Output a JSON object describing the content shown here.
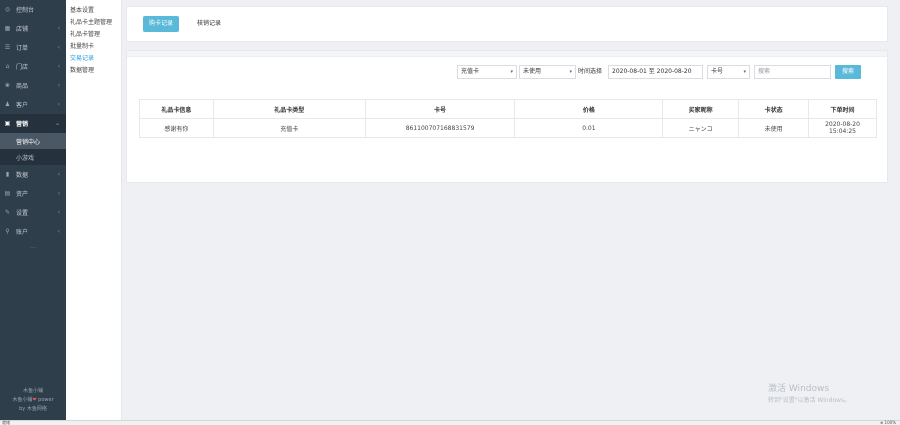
{
  "sidebar": {
    "items": [
      {
        "icon": "dashboard-icon",
        "glyph": "◎",
        "label": "控制台",
        "arrow": ""
      },
      {
        "icon": "store-icon",
        "glyph": "▦",
        "label": "店铺",
        "arrow": "‹"
      },
      {
        "icon": "order-icon",
        "glyph": "☰",
        "label": "订单",
        "arrow": "‹"
      },
      {
        "icon": "storefront-icon",
        "glyph": "⌂",
        "label": "门店",
        "arrow": "‹"
      },
      {
        "icon": "goods-icon",
        "glyph": "❀",
        "label": "商品",
        "arrow": "‹"
      },
      {
        "icon": "customer-icon",
        "glyph": "♟",
        "label": "客户",
        "arrow": "‹"
      }
    ],
    "active": {
      "icon": "marketing-icon",
      "glyph": "▣",
      "label": "营销",
      "arrow": "⌄"
    },
    "subitems": [
      "营销中心",
      "小游戏"
    ],
    "items_after": [
      {
        "icon": "data-icon",
        "glyph": "▮",
        "label": "数据",
        "arrow": "‹"
      },
      {
        "icon": "assets-icon",
        "glyph": "▤",
        "label": "资产",
        "arrow": "‹"
      },
      {
        "icon": "settings-icon",
        "glyph": "✎",
        "label": "设置",
        "arrow": "‹"
      },
      {
        "icon": "account-icon",
        "glyph": "⚲",
        "label": "账户",
        "arrow": "‹"
      }
    ],
    "more": "...",
    "footer": {
      "line1": "木鱼小铺",
      "line2_a": "木鱼小铺",
      "line2_b": "power",
      "line3": "by 木鱼网络"
    }
  },
  "submenu": {
    "items": [
      "基本设置",
      "礼品卡主题管理",
      "礼品卡管理",
      "批量制卡",
      "交易记录",
      "数据管理"
    ],
    "active_index": 4
  },
  "tabs": {
    "active": "购卡记录",
    "inactive": "核销记录"
  },
  "filters": {
    "card_type": "充值卡",
    "status": "未使用",
    "time_label": "时间选择",
    "date_range": "2020-08-01 至 2020-08-20",
    "field": "卡号",
    "search_placeholder": "搜索",
    "search_button": "搜索"
  },
  "table": {
    "headers": [
      "礼品卡信息",
      "礼品卡类型",
      "卡号",
      "价格",
      "买家昵称",
      "卡状态",
      "下单时间"
    ],
    "rows": [
      [
        "感谢有你",
        "充值卡",
        "861100707168831579",
        "0.01",
        "ニャンコ",
        "未使用",
        "2020-08-20 15:04:25"
      ]
    ]
  },
  "watermark": {
    "title": "激活 Windows",
    "sub": "转到\"设置\"以激活 Windows。"
  },
  "statusbar": {
    "left": "就绪",
    "right": "⊕ 100%"
  }
}
